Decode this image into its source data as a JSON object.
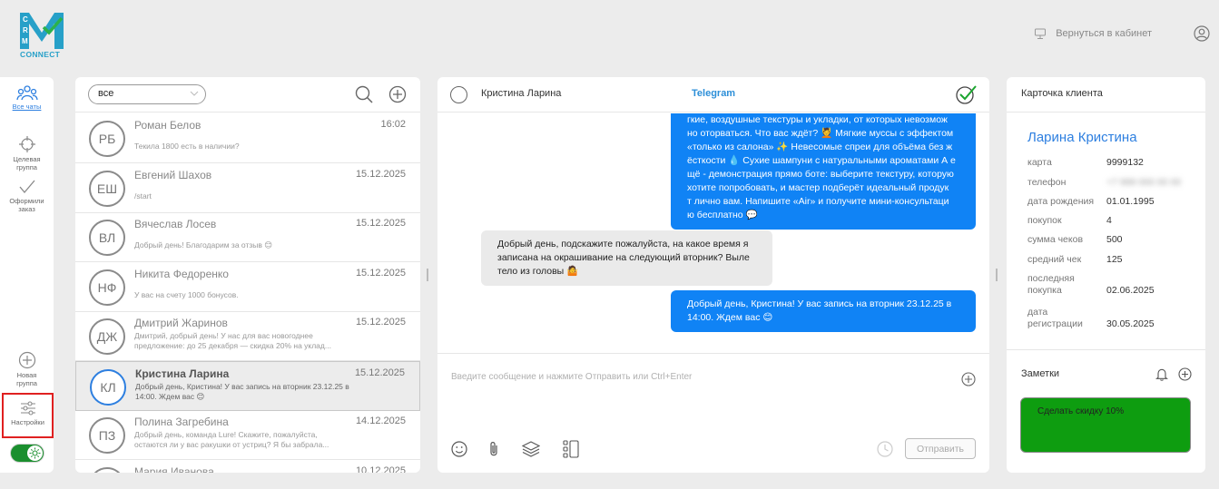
{
  "brand": {
    "logo_text": "CONNECT"
  },
  "header": {
    "back_label": "Вернуться в кабинет"
  },
  "sidebar": {
    "items": [
      {
        "id": "all",
        "label": "Все чаты"
      },
      {
        "id": "target",
        "label": "Целевая группа"
      },
      {
        "id": "orders",
        "label": "Оформили заказ"
      },
      {
        "id": "new-group",
        "label": "Новая группа"
      },
      {
        "id": "settings",
        "label": "Настройки"
      }
    ]
  },
  "chat_list": {
    "filter_value": "все",
    "chats": [
      {
        "initials": "РБ",
        "name": "Роман Белов",
        "date": "16:02",
        "preview": "Текила 1800 есть в наличии?",
        "selected": false
      },
      {
        "initials": "ЕШ",
        "name": "Евгений Шахов",
        "date": "15.12.2025",
        "preview": "/start",
        "selected": false
      },
      {
        "initials": "ВЛ",
        "name": "Вячеслав Лосев",
        "date": "15.12.2025",
        "preview": "Добрый день! Благодарим за отзыв 😊",
        "selected": false
      },
      {
        "initials": "НФ",
        "name": "Никита Федоренко",
        "date": "15.12.2025",
        "preview": "У вас на счету 1000 бонусов.",
        "selected": false
      },
      {
        "initials": "ДЖ",
        "name": "Дмитрий Жаринов",
        "date": "15.12.2025",
        "preview": "Дмитрий, добрый день! У нас для вас новогоднее предложение: до 25 декабря — скидка 20% на уклад...",
        "selected": false
      },
      {
        "initials": "КЛ",
        "name": "Кристина Ларина",
        "date": "15.12.2025",
        "preview": "Добрый день, Кристина! У вас запись на вторник 23.12.25 в 14:00. Ждем вас 😊",
        "selected": true
      },
      {
        "initials": "ПЗ",
        "name": "Полина Загребина",
        "date": "14.12.2025",
        "preview": "Добрый день, команда Lure! Скажите, пожалуйста, остаются ли у вас ракушки от устриц? Я бы забрала...",
        "selected": false
      },
      {
        "initials": "МИ",
        "name": "Мария Иванова",
        "date": "10.12.2025",
        "preview": "",
        "selected": false
      }
    ]
  },
  "conversation": {
    "contact_name": "Кристина Ларина",
    "channel": "Telegram",
    "messages": [
      {
        "direction": "out",
        "lines": [
          "гкие, воздушные текстуры и укладки, от которых невозмож",
          "но оторваться. Что вас ждёт? 💆 Мягкие муссы с эффектом",
          "«только из салона» ✨ Невесомые спреи для объёма без ж",
          "ёсткости 💧 Сухие шампуни с натуральными ароматами А е",
          "щё - демонстрация прямо боте: выберите текстуру, которую",
          "хотите попробовать, и мастер подберёт идеальный продук",
          "т лично вам. Напишите «Air» и получите мини-консультаци",
          "ю бесплатно 💬"
        ]
      },
      {
        "direction": "in",
        "lines": [
          "Добрый день, подскажите пожалуйста, на какое время я",
          "записана на окрашивание на следующий вторник? Выле",
          "тело из головы 🤷"
        ]
      },
      {
        "direction": "out",
        "lines": [
          "Добрый день, Кристина! У вас запись на вторник 23.12.25 в",
          "14:00. Ждем вас 😊"
        ]
      }
    ],
    "input_placeholder": "Введите сообщение и нажмите Отправить или Ctrl+Enter",
    "send_label": "Отправить"
  },
  "client_card": {
    "title": "Карточка клиента",
    "name": "Ларина Кристина",
    "fields": [
      {
        "label": "карта",
        "value": "9999132"
      },
      {
        "label": "телефон",
        "value": "+7 999 000 00 00",
        "blurred": true
      },
      {
        "label": "дата рождения",
        "value": "01.01.1995"
      },
      {
        "label": "покупок",
        "value": "4"
      },
      {
        "label": "сумма чеков",
        "value": "500"
      },
      {
        "label": "средний чек",
        "value": "125"
      },
      {
        "label": "последняя покупка",
        "value": "02.06.2025"
      },
      {
        "label": "дата регистрации",
        "value": "30.05.2025"
      }
    ],
    "notes_title": "Заметки",
    "note_text": "Сделать скидку 10%"
  },
  "colors": {
    "accent": "#2d7fe0",
    "bubble_out": "#1083f5",
    "bubble_in": "#eaeaea",
    "note_bg": "#0e9d10",
    "toggle_on": "#1a8f2e",
    "highlight": "#e02020"
  }
}
